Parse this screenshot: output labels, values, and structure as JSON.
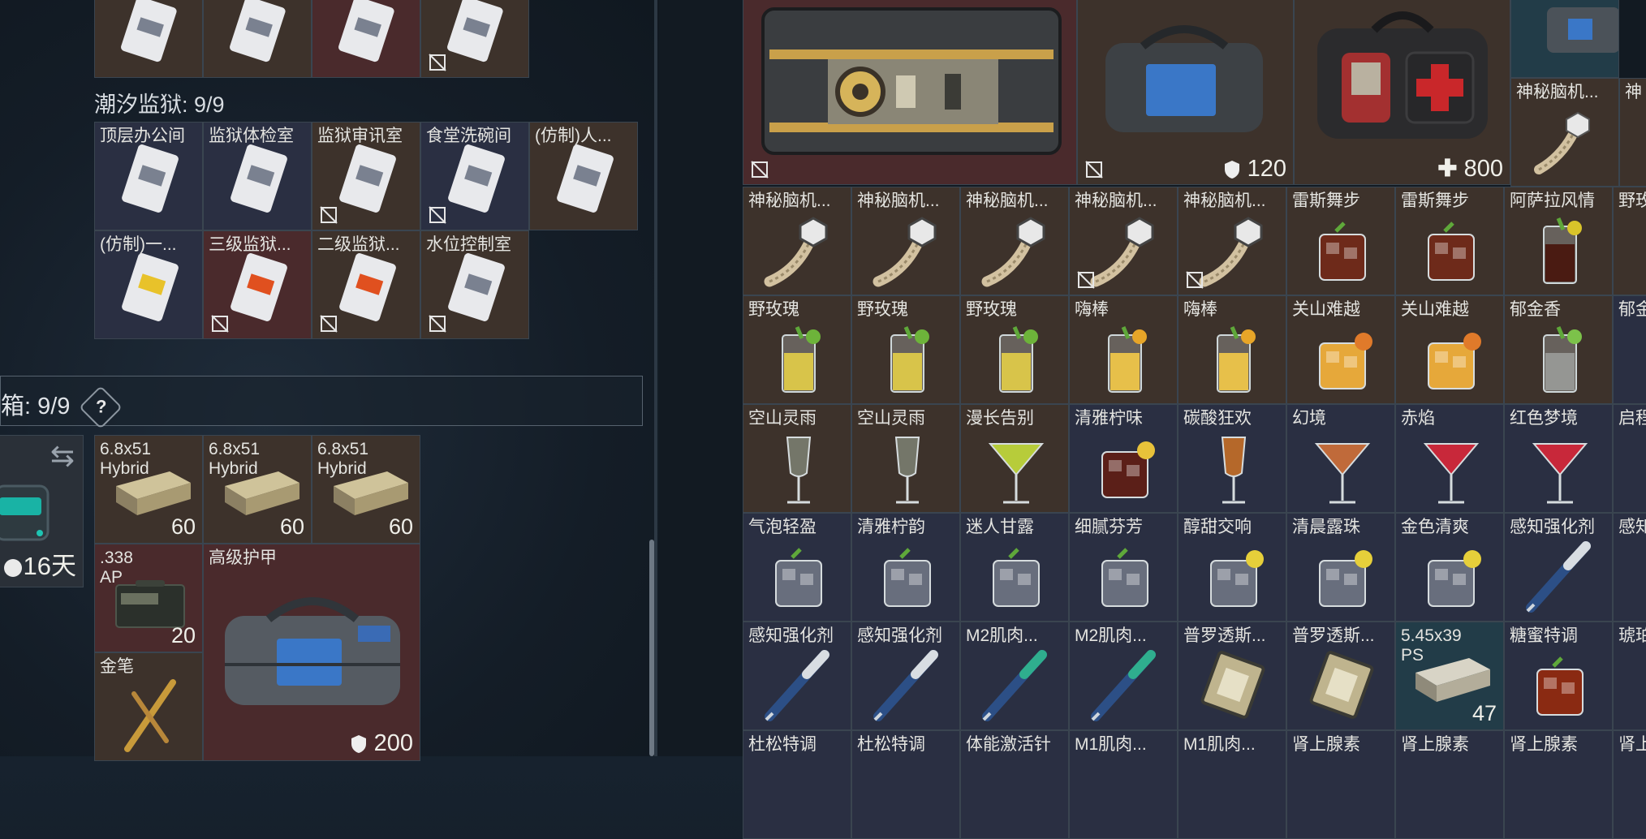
{
  "left": {
    "prison_label": "潮汐监狱: 9/9",
    "prison_cards": [
      {
        "name": "顶层办公间",
        "bound": false
      },
      {
        "name": "监狱体检室",
        "bound": false
      },
      {
        "name": "监狱审讯室",
        "bound": true
      },
      {
        "name": "食堂洗碗间",
        "bound": true
      },
      {
        "name": "(仿制)人...",
        "bound": false
      },
      {
        "name": "(仿制)一...",
        "bound": false
      },
      {
        "name": "三级监狱...",
        "bound": true
      },
      {
        "name": "二级监狱...",
        "bound": true
      },
      {
        "name": "水位控制室",
        "bound": true
      }
    ],
    "safe_box_label": "箱: 9/9",
    "help_symbol": "?",
    "swap_symbol": "⇆",
    "container_time": "16天",
    "ammo": [
      {
        "name": "6.8x51",
        "name2": "Hybrid",
        "count": "60"
      },
      {
        "name": "6.8x51",
        "name2": "Hybrid",
        "count": "60"
      },
      {
        "name": "6.8x51",
        "name2": "Hybrid",
        "count": "60"
      }
    ],
    "ap_ammo": {
      "name": ".338",
      "name2": "AP",
      "count": "20"
    },
    "armor_bag": {
      "name": "高级护甲",
      "value": "200"
    },
    "pen": {
      "name": "金笔"
    }
  },
  "right": {
    "case_value": "120",
    "aid_value": "800",
    "top_right_item": "神秘脑机...",
    "top_right_item_partial": "神",
    "rows": [
      [
        {
          "name": "神秘脑机...",
          "bound": false
        },
        {
          "name": "神秘脑机...",
          "bound": false
        },
        {
          "name": "神秘脑机...",
          "bound": false
        },
        {
          "name": "神秘脑机...",
          "bound": true
        },
        {
          "name": "神秘脑机...",
          "bound": true
        },
        {
          "name": "雷斯舞步",
          "bound": false
        },
        {
          "name": "雷斯舞步",
          "bound": false
        },
        {
          "name": "阿萨拉风情",
          "bound": false
        },
        {
          "name": "野玫",
          "bound": false
        }
      ],
      [
        {
          "name": "野玫瑰",
          "bound": false
        },
        {
          "name": "野玫瑰",
          "bound": false
        },
        {
          "name": "野玫瑰",
          "bound": false
        },
        {
          "name": "嗨棒",
          "bound": false
        },
        {
          "name": "嗨棒",
          "bound": false
        },
        {
          "name": "关山难越",
          "bound": false
        },
        {
          "name": "关山难越",
          "bound": false
        },
        {
          "name": "郁金香",
          "bound": false
        },
        {
          "name": "郁金",
          "bound": false
        }
      ],
      [
        {
          "name": "空山灵雨",
          "bound": false
        },
        {
          "name": "空山灵雨",
          "bound": false
        },
        {
          "name": "漫长告别",
          "bound": false
        },
        {
          "name": "清雅柠味",
          "bound": false
        },
        {
          "name": "碳酸狂欢",
          "bound": false
        },
        {
          "name": "幻境",
          "bound": false
        },
        {
          "name": "赤焰",
          "bound": false
        },
        {
          "name": "红色梦境",
          "bound": false
        },
        {
          "name": "启程",
          "bound": false
        }
      ],
      [
        {
          "name": "气泡轻盈",
          "bound": false
        },
        {
          "name": "清雅柠韵",
          "bound": false
        },
        {
          "name": "迷人甘露",
          "bound": false
        },
        {
          "name": "细腻芬芳",
          "bound": false
        },
        {
          "name": "醇甜交响",
          "bound": false
        },
        {
          "name": "清晨露珠",
          "bound": false
        },
        {
          "name": "金色清爽",
          "bound": false
        },
        {
          "name": "感知强化剂",
          "bound": false
        },
        {
          "name": "感知",
          "bound": false
        }
      ],
      [
        {
          "name": "感知强化剂",
          "bound": false
        },
        {
          "name": "感知强化剂",
          "bound": false
        },
        {
          "name": "M2肌肉...",
          "bound": false
        },
        {
          "name": "M2肌肉...",
          "bound": false
        },
        {
          "name": "普罗透斯...",
          "bound": false
        },
        {
          "name": "普罗透斯...",
          "bound": false
        },
        {
          "name": "5.45x39",
          "name2": "PS",
          "count": "47",
          "bound": false
        },
        {
          "name": "糖蜜特调",
          "bound": false
        },
        {
          "name": "琥珀",
          "bound": false
        }
      ],
      [
        {
          "name": "杜松特调",
          "bound": false
        },
        {
          "name": "杜松特调",
          "bound": false
        },
        {
          "name": "体能激活针",
          "bound": false
        },
        {
          "name": "M1肌肉...",
          "bound": false
        },
        {
          "name": "M1肌肉...",
          "bound": false
        },
        {
          "name": "肾上腺素",
          "bound": false
        },
        {
          "name": "肾上腺素",
          "bound": false
        },
        {
          "name": "肾上腺素",
          "bound": false
        },
        {
          "name": "肾上",
          "bound": false
        }
      ]
    ]
  }
}
